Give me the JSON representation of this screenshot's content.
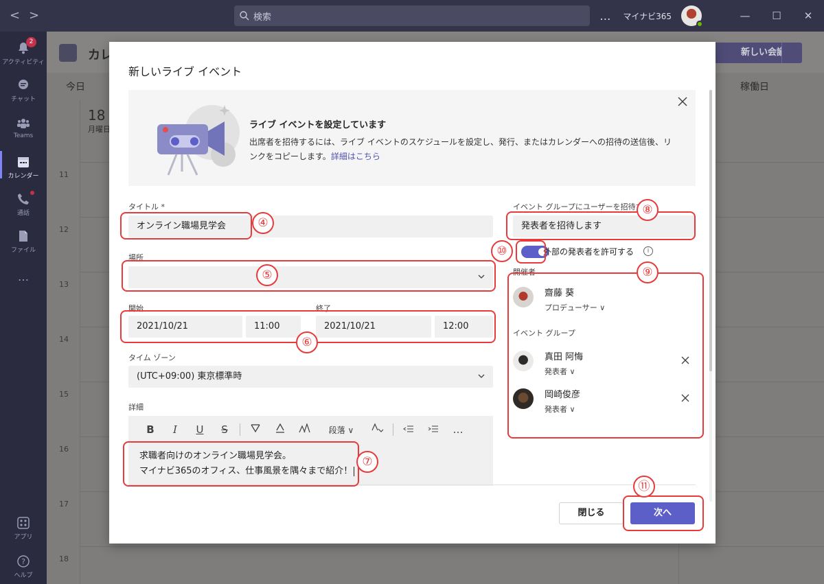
{
  "titlebar": {
    "back": "<",
    "forward": ">",
    "search_placeholder": "検索",
    "more": "…",
    "org": "マイナビ365",
    "minimize": "—",
    "maximize": "☐",
    "close": "✕"
  },
  "rail": [
    {
      "label": "アクティビティ",
      "icon": "bell-icon",
      "badge": "2"
    },
    {
      "label": "チャット",
      "icon": "chat-icon"
    },
    {
      "label": "Teams",
      "icon": "teams-icon"
    },
    {
      "label": "カレンダー",
      "icon": "calendar-icon",
      "active": true
    },
    {
      "label": "通話",
      "icon": "phone-icon"
    },
    {
      "label": "ファイル",
      "icon": "file-icon"
    },
    {
      "label": "…",
      "icon": "more-icon"
    },
    {
      "label": "アプリ",
      "icon": "apps-icon"
    },
    {
      "label": "ヘルプ",
      "icon": "help-icon"
    }
  ],
  "calendar": {
    "title": "カレ",
    "today": "今日",
    "view": "稼働日",
    "new_meeting": "新しい会議",
    "day_num": "18",
    "day_name": "月曜日",
    "hours": [
      "11",
      "12",
      "13",
      "14",
      "15",
      "16",
      "17",
      "18"
    ]
  },
  "modal": {
    "title": "新しいライブ イベント",
    "banner_heading": "ライブ イベントを設定しています",
    "banner_text": "出席者を招待するには、ライブ イベントのスケジュールを設定し、発行、またはカレンダーへの招待の送信後、リンクをコピーします。",
    "banner_link": "詳細はこちら",
    "title_label": "タイトル *",
    "title_value": "オンライン職場見学会",
    "location_label": "場所",
    "location_value": "",
    "start_label": "開始",
    "end_label": "終了",
    "start_date": "2021/10/21",
    "start_time": "11:00",
    "end_date": "2021/10/21",
    "end_time": "12:00",
    "timezone_label": "タイム ゾーン",
    "timezone_value": "(UTC+09:00) 東京標準時",
    "details_label": "詳細",
    "toolbar": {
      "bold": "B",
      "italic": "I",
      "underline": "U",
      "strike": "S",
      "paragraph": "段落 ∨",
      "more": "…"
    },
    "details_line1": "求職者向けのオンライン職場見学会。",
    "details_line2": "マイナビ365のオフィス、仕事風景を隅々まで紹介！",
    "invite_label": "イベント グループにユーザーを招待する",
    "invite_placeholder": "発表者を招待します",
    "external_toggle_label": "外部の発表者を許可する",
    "external_toggle_on": true,
    "organizer_label": "開催者",
    "organizer": {
      "name": "齋藤 葵",
      "role": "プロデューサー"
    },
    "group_label": "イベント グループ",
    "presenters": [
      {
        "name": "真田 阿悔",
        "role": "発表者"
      },
      {
        "name": "岡崎俊彦",
        "role": "発表者"
      }
    ],
    "close_button": "閉じる",
    "next_button": "次へ"
  },
  "annotations": [
    "④",
    "⑤",
    "⑥",
    "⑦",
    "⑧",
    "⑨",
    "⑩",
    "⑪"
  ],
  "colors": {
    "accent": "#5b5fc7",
    "annotation": "#e83a3a"
  }
}
